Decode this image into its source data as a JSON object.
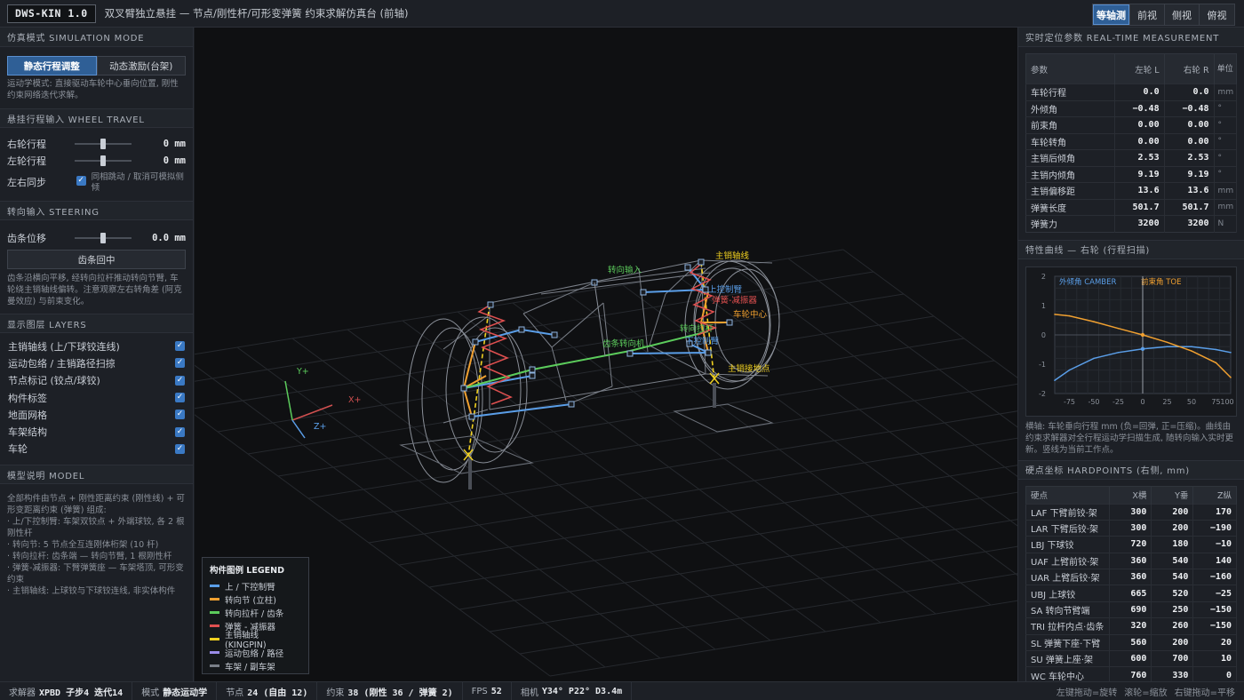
{
  "header": {
    "app_badge": "DWS-KIN 1.0",
    "title": "双叉臂独立悬挂 — 节点/刚性杆/可形变弹簧 约束求解仿真台 (前轴)",
    "views": [
      "等轴测",
      "前视",
      "侧视",
      "俯视"
    ],
    "active_view": "等轴测"
  },
  "left": {
    "sim_mode": {
      "title": "仿真模式 SIMULATION MODE",
      "buttons": [
        "静态行程调整",
        "动态激励(台架)"
      ],
      "note": "运动学模式: 直接驱动车轮中心垂向位置, 刚性约束网络迭代求解。"
    },
    "wheel_travel": {
      "title": "悬挂行程输入 WHEEL TRAVEL",
      "right_label": "右轮行程",
      "right_value": "0 mm",
      "right_level": 0.5,
      "left_label": "左轮行程",
      "left_value": "0 mm",
      "left_level": 0.5,
      "sync_label": "左右同步",
      "sync_text": "同相跳动 / 取消可模拟侧倾"
    },
    "steering": {
      "title": "转向输入 STEERING",
      "rack_label": "齿条位移",
      "rack_value": "0.0 mm",
      "rack_level": 0.5,
      "center_button": "齿条回中",
      "note": "齿条沿横向平移, 经转向拉杆推动转向节臂, 车轮绕主销轴线偏转。注意观察左右转角差 (阿克曼效应) 与前束变化。"
    },
    "layers": {
      "title": "显示图层 LAYERS",
      "items": [
        "主销轴线 (上/下球铰连线)",
        "运动包络 / 主销路径扫掠",
        "节点标记 (铰点/球铰)",
        "构件标签",
        "地面网格",
        "车架结构",
        "车轮"
      ]
    },
    "model": {
      "title": "模型说明 MODEL",
      "text": "全部构件由节点 + 刚性距离约束 (刚性线) + 可形变距离约束 (弹簧) 组成:\n· 上/下控制臂: 车架双铰点 + 外端球铰, 各 2 根刚性杆\n· 转向节: 5 节点全互连刚体桁架 (10 杆)\n· 转向拉杆: 齿条端 — 转向节臂, 1 根刚性杆\n· 弹簧-减振器: 下臂弹簧座 — 车架塔顶, 可形变约束\n· 主销轴线: 上球铰与下球铰连线, 非实体构件"
    }
  },
  "viewport": {
    "labels": {
      "kingpin_axis": "主销轴线",
      "steer_input": "转向输入",
      "upper_arm": "上控制臂",
      "spring_damper": "弹簧-减振器",
      "wheel_center": "车轮中心",
      "tie_rod": "转向拉杆",
      "lower_arm": "下控制臂",
      "rack": "齿条转向机",
      "contact_point": "主销接地点",
      "axis_x": "X+",
      "axis_y": "Y+",
      "axis_z": "Z+"
    },
    "legend": {
      "title": "构件图例 LEGEND",
      "items": [
        {
          "label": "上 / 下控制臂",
          "color": "#5a9ee8"
        },
        {
          "label": "转向节 (立柱)",
          "color": "#f0a030"
        },
        {
          "label": "转向拉杆 / 齿条",
          "color": "#5ccc5c"
        },
        {
          "label": "弹簧 - 减振器",
          "color": "#e05050"
        },
        {
          "label": "主销轴线 (KINGPIN)",
          "color": "#f0d020"
        },
        {
          "label": "运动包络 / 路径",
          "color": "#9a8ce8"
        },
        {
          "label": "车架 / 副车架",
          "color": "#7a7f88"
        }
      ]
    }
  },
  "right": {
    "measurement": {
      "title": "实时定位参数 REAL-TIME MEASUREMENT",
      "headers": [
        "参数",
        "左轮 L",
        "右轮 R",
        "单位"
      ],
      "rows": [
        [
          "车轮行程",
          "0.0",
          "0.0",
          "mm"
        ],
        [
          "外倾角",
          "−0.48",
          "−0.48",
          "°"
        ],
        [
          "前束角",
          "0.00",
          "0.00",
          "°"
        ],
        [
          "车轮转角",
          "0.00",
          "0.00",
          "°"
        ],
        [
          "主销后倾角",
          "2.53",
          "2.53",
          "°"
        ],
        [
          "主销内倾角",
          "9.19",
          "9.19",
          "°"
        ],
        [
          "主销偏移距",
          "13.6",
          "13.6",
          "mm"
        ],
        [
          "弹簧长度",
          "501.7",
          "501.7",
          "mm"
        ],
        [
          "弹簧力",
          "3200",
          "3200",
          "N"
        ]
      ]
    },
    "curve": {
      "title": "特性曲线 — 右轮 (行程扫描)",
      "note": "横轴: 车轮垂向行程 mm (负=回弹, 正=压缩)。曲线由约束求解器对全行程运动学扫描生成, 随转向输入实时更新。竖线为当前工作点。"
    },
    "hardpoints": {
      "title": "硬点坐标 HARDPOINTS (右侧, mm)",
      "headers": [
        "硬点",
        "X横",
        "Y垂",
        "Z纵"
      ],
      "rows": [
        [
          "LAF 下臂前铰·架",
          "300",
          "200",
          "170"
        ],
        [
          "LAR 下臂后铰·架",
          "300",
          "200",
          "−190"
        ],
        [
          "LBJ 下球铰",
          "720",
          "180",
          "−10"
        ],
        [
          "UAF 上臂前铰·架",
          "360",
          "540",
          "140"
        ],
        [
          "UAR 上臂后铰·架",
          "360",
          "540",
          "−160"
        ],
        [
          "UBJ 上球铰",
          "665",
          "520",
          "−25"
        ],
        [
          "SA 转向节臂端",
          "690",
          "250",
          "−150"
        ],
        [
          "TRI 拉杆内点·齿条",
          "320",
          "260",
          "−150"
        ],
        [
          "SL 弹簧下座·下臂",
          "560",
          "200",
          "20"
        ],
        [
          "SU 弹簧上座·架",
          "600",
          "700",
          "10"
        ],
        [
          "WC 车轮中心",
          "760",
          "330",
          "0"
        ]
      ]
    }
  },
  "chart_data": {
    "type": "line",
    "title": "",
    "xlabel": "",
    "ylabel": "",
    "x": [
      -90,
      -75,
      -50,
      -25,
      0,
      25,
      50,
      75,
      90
    ],
    "xlim": [
      -90,
      90
    ],
    "ylim": [
      -2,
      2
    ],
    "x_ticks": [
      -75,
      -50,
      -25,
      0,
      25,
      50,
      75,
      100
    ],
    "y_ticks": [
      2,
      1,
      0,
      -1,
      -2
    ],
    "current_x": 0,
    "grid": true,
    "legend": "top-left",
    "series": [
      {
        "name": "外倾角 CAMBER",
        "color": "#5a9ee8",
        "values": [
          -1.55,
          -1.2,
          -0.8,
          -0.6,
          -0.48,
          -0.4,
          -0.4,
          -0.5,
          -0.6
        ]
      },
      {
        "name": "前束角 TOE",
        "color": "#f0a030",
        "values": [
          0.7,
          0.65,
          0.45,
          0.22,
          0.0,
          -0.25,
          -0.55,
          -0.95,
          -1.45
        ]
      }
    ]
  },
  "status": {
    "solver_label": "求解器",
    "solver": "XPBD 子步4 迭代14",
    "mode_label": "模式",
    "mode": "静态运动学",
    "nodes_label": "节点",
    "nodes": "24 (自由 12)",
    "constraints_label": "约束",
    "constraints": "38 (刚性 36 / 弹簧 2)",
    "fps_label": "FPS",
    "fps": "52",
    "camera_label": "相机",
    "camera": "Y34° P22° D3.4m",
    "hints": [
      "左键拖动=旋转",
      "滚轮=缩放",
      "右键拖动=平移"
    ]
  }
}
